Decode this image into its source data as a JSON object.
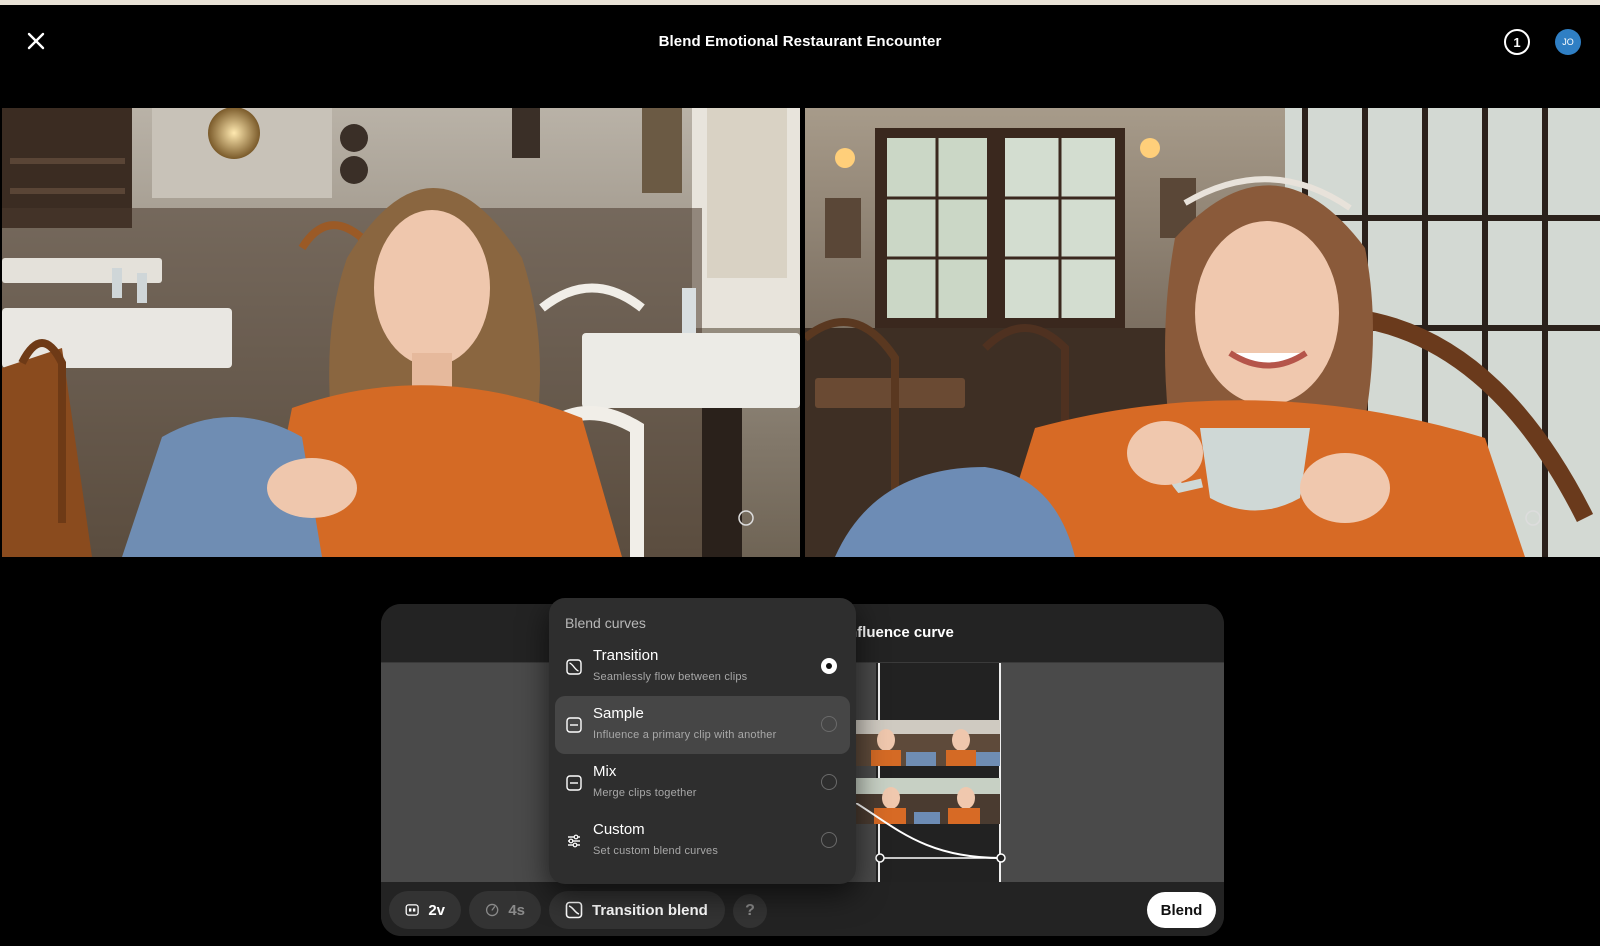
{
  "header": {
    "title": "Blend Emotional Restaurant Encounter",
    "notification_count": "1",
    "avatar_initials": "JO"
  },
  "clips": [
    {
      "name": "clip-left"
    },
    {
      "name": "clip-right"
    }
  ],
  "panel": {
    "header_label": "nfluence curve"
  },
  "dropdown": {
    "title": "Blend curves",
    "options": [
      {
        "label": "Transition",
        "desc": "Seamlessly flow between clips",
        "icon": "transition-curve-icon",
        "selected": true
      },
      {
        "label": "Sample",
        "desc": "Influence a primary clip with another",
        "icon": "sample-curve-icon",
        "selected": false
      },
      {
        "label": "Mix",
        "desc": "Merge clips together",
        "icon": "mix-curve-icon",
        "selected": false
      },
      {
        "label": "Custom",
        "desc": "Set custom blend curves",
        "icon": "sliders-icon",
        "selected": false
      }
    ]
  },
  "toolbar": {
    "clips_count": "2v",
    "duration": "4s",
    "mode_label": "Transition blend",
    "help_label": "?",
    "blend_label": "Blend"
  },
  "colors": {
    "accent_avatar": "#2f7fc4",
    "sweater_orange": "#d76a25"
  }
}
